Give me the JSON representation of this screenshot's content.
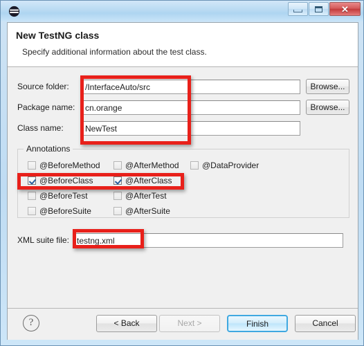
{
  "window": {
    "icon_name": "eclipse-logo-icon",
    "title": "",
    "controls": {
      "minimize": "minimize-icon",
      "maximize": "restore-icon",
      "close": "✕"
    }
  },
  "header": {
    "title": "New TestNG class",
    "description": "Specify additional information about the test class."
  },
  "form": {
    "fields": [
      {
        "label": "Source folder:",
        "value": "/InterfaceAuto/src",
        "browse": "Browse..."
      },
      {
        "label": "Package name:",
        "value": "cn.orange",
        "browse": "Browse..."
      },
      {
        "label": "Class name:",
        "value": "NewTest",
        "browse": null
      }
    ]
  },
  "annotations": {
    "legend": "Annotations",
    "rows": [
      [
        {
          "label": "@BeforeMethod",
          "checked": false
        },
        {
          "label": "@AfterMethod",
          "checked": false
        },
        {
          "label": "@DataProvider",
          "checked": false
        }
      ],
      [
        {
          "label": "@BeforeClass",
          "checked": true
        },
        {
          "label": "@AfterClass",
          "checked": true
        }
      ],
      [
        {
          "label": "@BeforeTest",
          "checked": false
        },
        {
          "label": "@AfterTest",
          "checked": false
        }
      ],
      [
        {
          "label": "@BeforeSuite",
          "checked": false
        },
        {
          "label": "@AfterSuite",
          "checked": false
        }
      ]
    ]
  },
  "xml_suite": {
    "label": "XML suite file:",
    "value": "testng.xml"
  },
  "footer": {
    "help": "?",
    "buttons": [
      {
        "name": "back",
        "label": "< Back",
        "state": "enabled"
      },
      {
        "name": "next",
        "label": "Next >",
        "state": "disabled"
      },
      {
        "name": "finish",
        "label": "Finish",
        "state": "default"
      },
      {
        "name": "cancel",
        "label": "Cancel",
        "state": "enabled"
      }
    ]
  },
  "colors": {
    "annotation_red": "#e8201a",
    "titlebar_blue": "#b9daf2",
    "default_button_border": "#3fa8e0",
    "dialog_bg": "#f0f0f0"
  }
}
